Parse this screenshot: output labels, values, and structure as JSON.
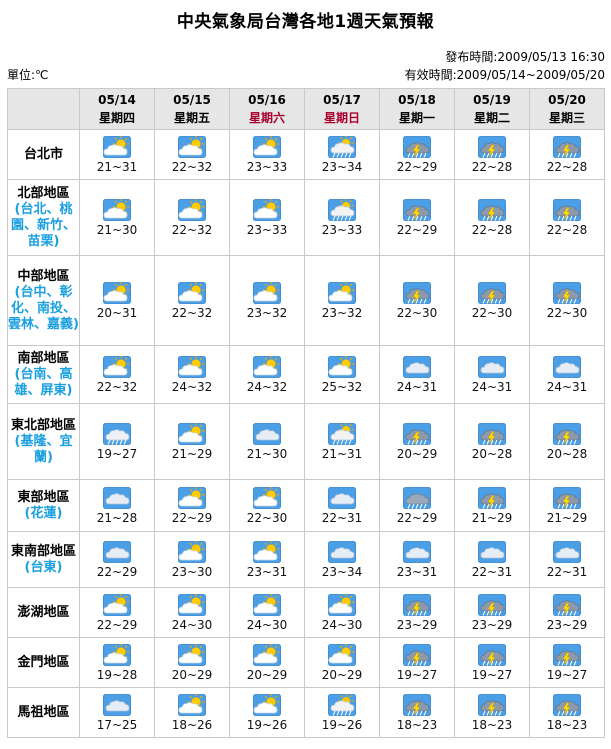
{
  "title": "中央氣象局台灣各地1週天氣預報",
  "published": "發布時間:2009/05/13 16:30",
  "unit": "單位:℃",
  "valid": "有效時間:2009/05/14~2009/05/20",
  "days": [
    {
      "date": "05/14",
      "weekday": "星期四",
      "weekend": false
    },
    {
      "date": "05/15",
      "weekday": "星期五",
      "weekend": false
    },
    {
      "date": "05/16",
      "weekday": "星期六",
      "weekend": true
    },
    {
      "date": "05/17",
      "weekday": "星期日",
      "weekend": true
    },
    {
      "date": "05/18",
      "weekday": "星期一",
      "weekend": false
    },
    {
      "date": "05/19",
      "weekday": "星期二",
      "weekend": false
    },
    {
      "date": "05/20",
      "weekday": "星期三",
      "weekend": false
    }
  ],
  "regions": [
    {
      "name": "台北市",
      "sub": "",
      "h": 50,
      "icons": [
        "partly-cloudy",
        "partly-cloudy",
        "partly-cloudy",
        "sun-rain",
        "thunderstorm",
        "thunderstorm",
        "thunderstorm"
      ],
      "temps": [
        "21~31",
        "22~32",
        "23~33",
        "23~34",
        "22~29",
        "22~28",
        "22~28"
      ]
    },
    {
      "name": "北部地區",
      "sub": "(台北、桃園、新竹、苗栗)",
      "h": 76,
      "icons": [
        "partly-cloudy",
        "partly-cloudy",
        "partly-cloudy",
        "sun-rain",
        "thunderstorm",
        "thunderstorm",
        "thunderstorm"
      ],
      "temps": [
        "21~30",
        "22~32",
        "23~33",
        "23~33",
        "22~29",
        "22~28",
        "22~28"
      ]
    },
    {
      "name": "中部地區",
      "sub": "(台中、彰化、南投、雲林、嘉義)",
      "h": 90,
      "icons": [
        "partly-cloudy",
        "partly-cloudy",
        "partly-cloudy",
        "partly-cloudy",
        "thunderstorm",
        "thunderstorm",
        "thunderstorm"
      ],
      "temps": [
        "20~31",
        "22~32",
        "23~32",
        "23~32",
        "22~30",
        "22~30",
        "22~30"
      ]
    },
    {
      "name": "南部地區",
      "sub": "(台南、高雄、屏東)",
      "h": 58,
      "icons": [
        "partly-cloudy",
        "partly-cloudy",
        "partly-cloudy",
        "partly-cloudy",
        "cloudy",
        "cloudy",
        "cloudy"
      ],
      "temps": [
        "22~32",
        "24~32",
        "24~32",
        "25~32",
        "24~31",
        "24~31",
        "24~31"
      ]
    },
    {
      "name": "東北部地區",
      "sub": "(基隆、宜蘭)",
      "h": 76,
      "icons": [
        "rain",
        "partly-cloudy",
        "cloudy",
        "sun-rain",
        "thunderstorm",
        "thunderstorm",
        "thunderstorm"
      ],
      "temps": [
        "19~27",
        "21~29",
        "21~30",
        "21~31",
        "20~29",
        "20~28",
        "20~28"
      ]
    },
    {
      "name": "東部地區",
      "sub": "(花蓮)",
      "h": 52,
      "icons": [
        "cloudy",
        "partly-cloudy",
        "partly-cloudy",
        "cloudy",
        "rain-cloud",
        "thunderstorm",
        "thunderstorm"
      ],
      "temps": [
        "21~28",
        "22~29",
        "22~30",
        "22~31",
        "22~29",
        "21~29",
        "21~29"
      ]
    },
    {
      "name": "東南部地區",
      "sub": "(台東)",
      "h": 56,
      "icons": [
        "cloudy",
        "partly-cloudy",
        "partly-cloudy",
        "cloudy",
        "cloudy",
        "cloudy",
        "cloudy"
      ],
      "temps": [
        "22~29",
        "23~30",
        "23~31",
        "23~34",
        "23~31",
        "22~31",
        "22~31"
      ]
    },
    {
      "name": "澎湖地區",
      "sub": "",
      "h": 50,
      "icons": [
        "partly-cloudy",
        "partly-cloudy",
        "partly-cloudy",
        "partly-cloudy",
        "thunderstorm",
        "thunderstorm",
        "thunderstorm"
      ],
      "temps": [
        "22~29",
        "24~30",
        "24~30",
        "24~30",
        "23~29",
        "23~29",
        "23~29"
      ]
    },
    {
      "name": "金門地區",
      "sub": "",
      "h": 50,
      "icons": [
        "partly-cloudy",
        "partly-cloudy",
        "partly-cloudy",
        "partly-cloudy",
        "thunderstorm",
        "thunderstorm",
        "thunderstorm"
      ],
      "temps": [
        "19~28",
        "20~29",
        "20~29",
        "20~29",
        "19~27",
        "19~27",
        "19~27"
      ]
    },
    {
      "name": "馬祖地區",
      "sub": "",
      "h": 50,
      "icons": [
        "cloudy",
        "partly-cloudy",
        "partly-cloudy",
        "sun-rain",
        "thunderstorm",
        "thunderstorm",
        "thunderstorm"
      ],
      "temps": [
        "17~25",
        "18~26",
        "19~26",
        "19~26",
        "18~23",
        "18~23",
        "18~23"
      ]
    }
  ],
  "colors": {
    "header_bg": "#e6e6e6",
    "weekend": "#a8002c",
    "subregion": "#1aa0e0",
    "grid": "#c9c9c9"
  }
}
